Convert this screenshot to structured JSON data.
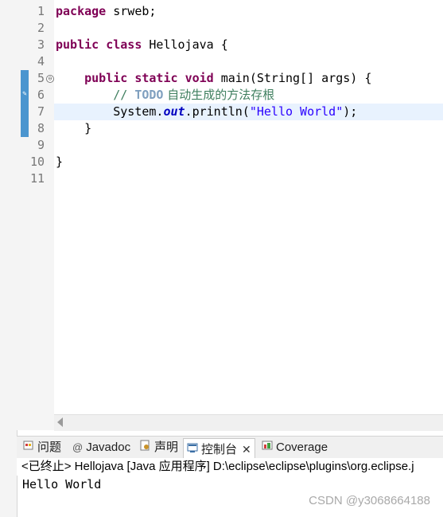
{
  "editor": {
    "lines": [
      {
        "n": "1",
        "text": ""
      },
      {
        "n": "2",
        "text": ""
      },
      {
        "n": "3",
        "text": ""
      },
      {
        "n": "4",
        "text": ""
      },
      {
        "n": "5",
        "text": ""
      },
      {
        "n": "6",
        "text": ""
      },
      {
        "n": "7",
        "text": ""
      },
      {
        "n": "8",
        "text": ""
      },
      {
        "n": "9",
        "text": ""
      },
      {
        "n": "10",
        "text": ""
      },
      {
        "n": "11",
        "text": ""
      }
    ],
    "code": {
      "l1_kw": "package",
      "l1_rest": " srweb;",
      "l3_kw1": "public",
      "l3_kw2": "class",
      "l3_rest": " Hellojava {",
      "l5_kw1": "public",
      "l5_kw2": "static",
      "l5_kw3": "void",
      "l5_rest": " main(String[] args) {",
      "l6_comment": "// ",
      "l6_todo": "TODO",
      "l6_comment2": " 自动生成的方法存根",
      "l7_pre": "System.",
      "l7_field": "out",
      "l7_mid": ".println(",
      "l7_str": "\"Hello World\"",
      "l7_end": ");",
      "l8": "}",
      "l10": "}"
    },
    "fold_symbol": "⊖"
  },
  "panel": {
    "tabs": [
      {
        "label": "问题",
        "icon": "problems-icon"
      },
      {
        "label": "Javadoc",
        "icon": "javadoc-icon"
      },
      {
        "label": "声明",
        "icon": "declaration-icon"
      },
      {
        "label": "控制台",
        "icon": "console-icon"
      },
      {
        "label": "Coverage",
        "icon": "coverage-icon"
      }
    ],
    "javadoc_at": "@",
    "close": "✕",
    "console_header": "<已终止> Hellojava [Java 应用程序] D:\\eclipse\\eclipse\\plugins\\org.eclipse.j",
    "console_output": "Hello World"
  },
  "watermark": "CSDN @y3068664188"
}
